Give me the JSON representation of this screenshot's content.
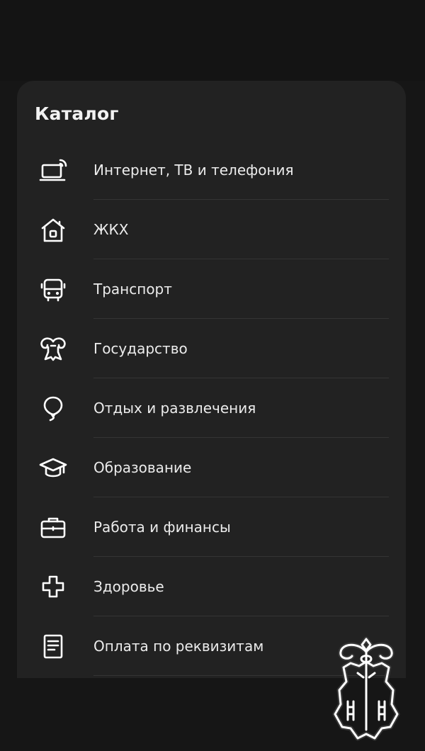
{
  "catalog": {
    "title": "Каталог",
    "items": [
      {
        "label": "Интернет, ТВ и телефония",
        "icon": "laptop-signal-icon"
      },
      {
        "label": "ЖКХ",
        "icon": "house-icon"
      },
      {
        "label": "Транспорт",
        "icon": "bus-icon"
      },
      {
        "label": "Государство",
        "icon": "coat-of-arms-icon"
      },
      {
        "label": "Отдых и развлечения",
        "icon": "balloon-icon"
      },
      {
        "label": "Образование",
        "icon": "graduation-cap-icon"
      },
      {
        "label": "Работа и финансы",
        "icon": "briefcase-icon"
      },
      {
        "label": "Здоровье",
        "icon": "medical-cross-icon"
      },
      {
        "label": "Оплата по реквизитам",
        "icon": "document-icon"
      }
    ]
  },
  "colors": {
    "background": "#161616",
    "sheet": "#222222",
    "text": "#ececec",
    "divider": "#343434"
  },
  "watermark": {
    "icon": "emblem-watermark-icon"
  }
}
